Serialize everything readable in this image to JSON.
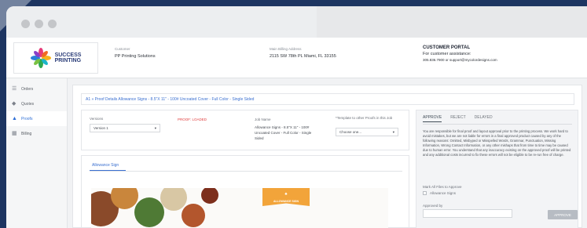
{
  "header": {
    "customer_label": "Customer",
    "customer_value": "PP Printing Solutions",
    "address_label": "Main Billing Address",
    "address_value": "2115 SW 78th PL Miami, FL 33155",
    "portal_title": "CUSTOMER PORTAL",
    "portal_subtitle": "For customer assistance:",
    "portal_contact": "305.836.7900 or support@mycolordesigns.com"
  },
  "logo": {
    "line1": "SUCCESS",
    "line2": "PRINTING"
  },
  "sidebar": {
    "items": [
      {
        "label": "Orders",
        "icon": "layers-icon",
        "active": false
      },
      {
        "label": "Quotes",
        "icon": "tag-icon",
        "active": false
      },
      {
        "label": "Proofs",
        "icon": "stamp-icon",
        "active": true
      },
      {
        "label": "Billing",
        "icon": "billing-icon",
        "active": false
      }
    ]
  },
  "breadcrumb": "A1 » Proof Details Allowance Signs - 8.5\"X 11\" - 100# Uncoated Cover - Full Color - Single Sided",
  "form": {
    "versions_label": "Versions",
    "versions_value": "Version 1",
    "proof_status": "PROOF: LOADED",
    "job_name_label": "Job Name",
    "job_name_value": "Allowance Signs - 8.5\"X 11\" - 100# Uncoated Cover - Full Color - Single Sided",
    "template_label": "*Template to other Proofs in this Job",
    "template_placeholder": "Choose one..."
  },
  "right_panel": {
    "tabs": [
      "APPROVE",
      "REJECT",
      "DELAYED"
    ],
    "text": "You are responsible for final proof and layout approval prior to the printing process. We work hard to avoid mistakes, but we are not liable for errors in a final approved product caused by any of the following reasons: Omitted, Misbyped or Misspelled Words, Grammar, Punctuation, Missing Information, Wrong Contact Information, or any other mishaps that from time to time may be caused due to human error. You understand that any inaccuracy existing on the approved proof will be printed and any additional costs incurred to fix these errors will not be eligible to be re-run free of charge.",
    "mark_label": "Mark All Files to Approve",
    "checkbox_label": "Allowance Signs",
    "approved_label": "Approved by",
    "submit_label": "APPROVE"
  },
  "preview": {
    "tab_label": "Allowance Sign",
    "ribbon_text": "ALLOWANCE SIGN"
  },
  "colors": {
    "background": "#1d3561",
    "accent": "#3a6fd0",
    "status_red": "#e03c3c",
    "ribbon": "#f2a43a"
  }
}
